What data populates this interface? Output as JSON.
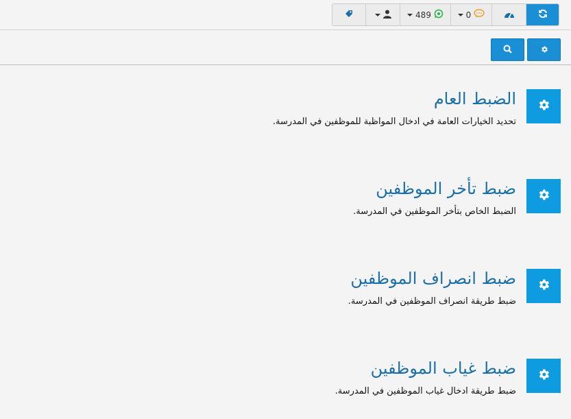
{
  "toolbar": {
    "whatsapp_count": "489",
    "messages_count": "0",
    "icons": [
      "refresh-icon",
      "dashboard-icon",
      "chat-icon",
      "whatsapp-icon",
      "user-icon",
      "tag-icon"
    ]
  },
  "subbar": {
    "icons": [
      "gear-icon",
      "search-icon"
    ]
  },
  "sections": [
    {
      "title": "الضبط العام",
      "description": "تحديد الخيارات العامة في ادخال المواظبة للموظفين في المدرسة."
    },
    {
      "title": "ضبط تأخر الموظفين",
      "description": "الضبط الخاص بتأخر الموظفين في المدرسة."
    },
    {
      "title": "ضبط انصراف الموظفين",
      "description": "ضبط طريقة انصراف الموظفين في المدرسة."
    },
    {
      "title": "ضبط غياب الموظفين",
      "description": "ضبط طريقة ادخال غياب الموظفين في المدرسة."
    }
  ],
  "colors": {
    "primary": "#1a8fd6",
    "tile": "#0e9be0",
    "title": "#1a6fa8",
    "whatsapp": "#2fb24c",
    "chat": "#f0a030"
  }
}
